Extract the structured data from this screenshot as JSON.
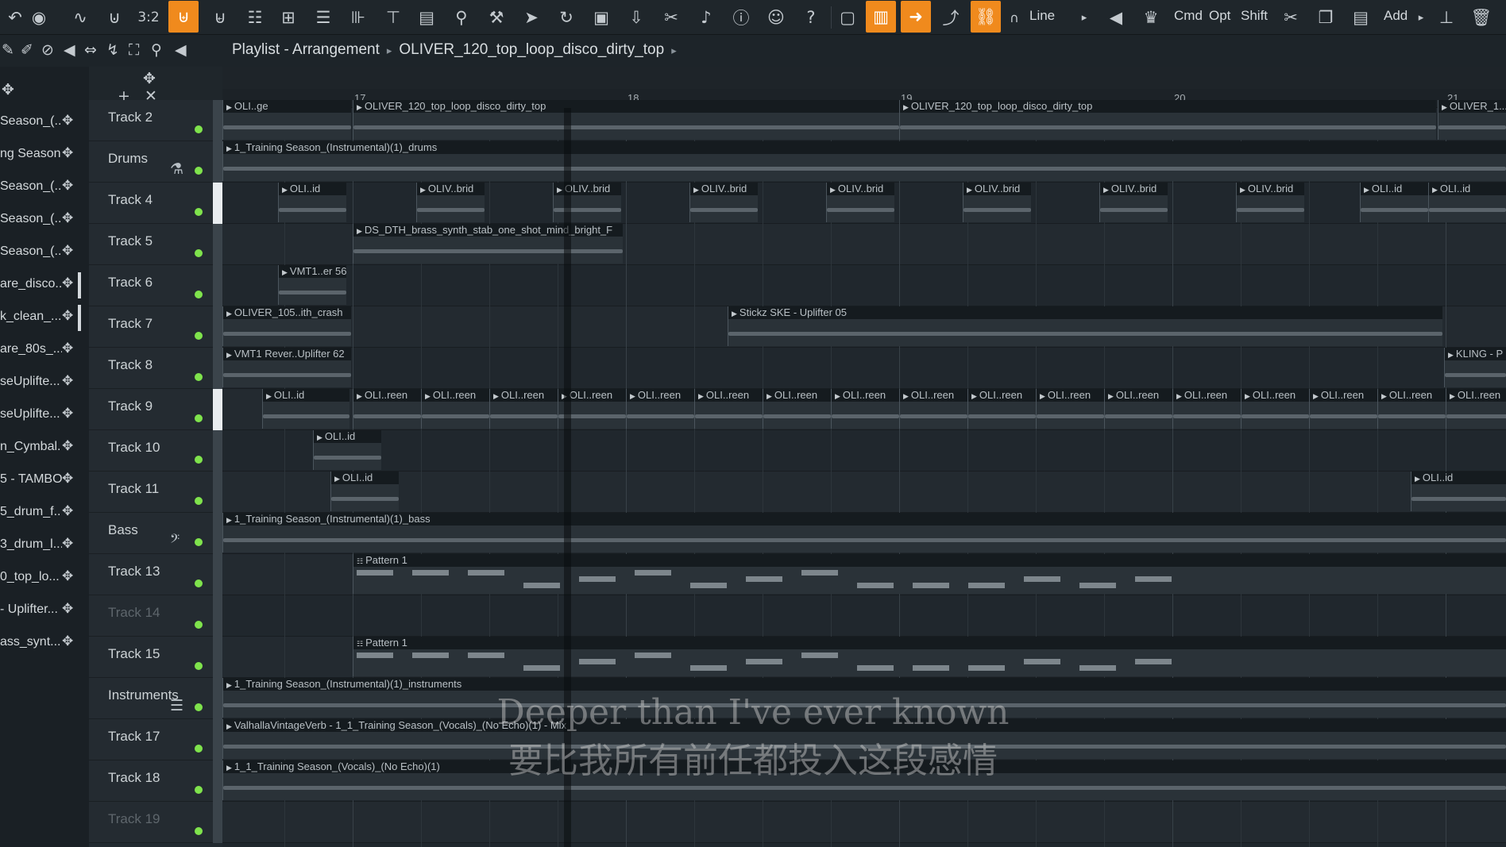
{
  "toolbar": {
    "snap_label": "Line",
    "cmd_label": "Cmd",
    "opt_label": "Opt",
    "shift_label": "Shift",
    "add_label": "Add",
    "accent_color": "#f08a1d"
  },
  "breadcrumb": {
    "view": "Playlist - Arrangement",
    "item": "OLIVER_120_top_loop_disco_dirty_top"
  },
  "channels": [
    "Season_(...",
    "ng Season...",
    "Season_(...",
    "Season_(...",
    "Season_(...",
    "are_disco...",
    "k_clean_...",
    "are_80s_...",
    "seUplifte...",
    "seUplifte...",
    "n_Cymbal...",
    "5 - TAMBO...",
    "5_drum_f...",
    "3_drum_l...",
    "0_top_lo...",
    "- Uplifter...",
    "ass_synt..."
  ],
  "ruler": {
    "bars": [
      "17",
      "18",
      "19",
      "20",
      "21"
    ]
  },
  "tracks": [
    "Track 2",
    "Drums",
    "Track 4",
    "Track 5",
    "Track 6",
    "Track 7",
    "Track 8",
    "Track 9",
    "Track 10",
    "Track 11",
    "Bass",
    "Track 13",
    "Track 14",
    "Track 15",
    "Instruments",
    "Track 17",
    "Track 18",
    "Track 19"
  ],
  "clips": {
    "t2_a": "OLI..ge",
    "t2_b": "OLIVER_120_top_loop_disco_dirty_top",
    "t2_c": "OLIVER_120_top_loop_disco_dirty_top",
    "t2_d": "OLIVER_1...",
    "drums": "1_Training Season_(Instrumental)(1)_drums",
    "t4_id": "OLI..id",
    "t4_brid": "OLIV..brid",
    "t5": "DS_DTH_brass_synth_stab_one_shot_mind_bright_F",
    "t6": "VMT1..er 56",
    "t7_a": "OLIVER_105..ith_crash",
    "t7_b": "Stickz SKE - Uplifter 05",
    "t8_a": "VMT1 Rever..Uplifter 62",
    "t8_b": "KLING - P",
    "t9_id": "OLI..id",
    "t9_reen": "OLI..reen",
    "t10": "OLI..id",
    "t11": "OLI..id",
    "bass": "1_Training Season_(Instrumental)(1)_bass",
    "pattern": "Pattern 1",
    "instruments": "1_Training Season_(Instrumental)(1)_instruments",
    "t17": "ValhallaVintageVerb - 1_1_Training Season_(Vocals)_(No Echo)(1) - Mix",
    "t18": "1_1_Training Season_(Vocals)_(No Echo)(1)"
  },
  "subtitles": {
    "english": "Deeper than I've ever known",
    "chinese": "要比我所有前任都投入这段感情"
  }
}
